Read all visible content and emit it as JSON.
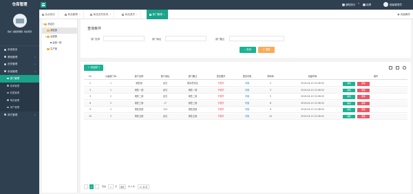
{
  "app": {
    "title": "仓库管理"
  },
  "topbar": {
    "notice": "通知提示",
    "lock": "锁屏",
    "user": "超级管理员"
  },
  "sidebar": {
    "profile_text": "您好！超级管理员, 欢迎登录",
    "items": [
      {
        "label": "系统首页",
        "icon": "home-icon"
      },
      {
        "label": "基础管理",
        "icon": "database-icon"
      },
      {
        "label": "进货管理",
        "icon": "cart-icon"
      },
      {
        "label": "系统管理",
        "icon": "gear-icon"
      }
    ],
    "sub_items": [
      {
        "label": "部门管理",
        "active": true
      },
      {
        "label": "菜单管理"
      },
      {
        "label": "权限管理"
      },
      {
        "label": "角色管理"
      },
      {
        "label": "用户管理"
      }
    ],
    "other": {
      "label": "其它管理",
      "icon": "grid-icon"
    }
  },
  "tabs": [
    {
      "label": "后台首页"
    },
    {
      "label": "商品管理"
    },
    {
      "label": "商品进货查询"
    },
    {
      "label": "商品退货"
    },
    {
      "label": "部门管理",
      "active": true
    }
  ],
  "page_ops": "页面操作",
  "tree": {
    "nodes": [
      {
        "label": "总经办"
      },
      {
        "label": "销售部"
      },
      {
        "label": "运营部"
      },
      {
        "label": "运营一部"
      },
      {
        "label": "生产部"
      }
    ]
  },
  "search": {
    "title": "查询条件",
    "fields": [
      {
        "label": "部门名称",
        "value": ""
      },
      {
        "label": "部门地址",
        "value": ""
      },
      {
        "label": "部门备注",
        "value": ""
      }
    ],
    "search_btn": "查询",
    "reset_btn": "重置"
  },
  "table": {
    "add_btn": "添加部门",
    "columns": [
      "ID",
      "父级部门ID",
      "部门名称",
      "部门地址",
      "部门备注",
      "是否展开",
      "是否可用",
      "排序码",
      "创建时间",
      "操作"
    ],
    "rows": [
      [
        "2",
        "1",
        "销售部",
        "武汉",
        "程序员屌丝",
        "不展开",
        "可用",
        "2",
        "2019-04-10 22:06:32"
      ],
      [
        "3",
        "1",
        "销售一部",
        "武汉",
        "销售一部",
        "不展开",
        "可用",
        "3",
        "2019-04-10 22:06:32"
      ],
      [
        "5",
        "2",
        "销售二部",
        "武汉",
        "销售二部",
        "不展开",
        "可用",
        "5",
        "2019-04-10 22:06:32"
      ],
      [
        "8",
        "2",
        "销售三部",
        "17",
        "销售三部",
        "不展开",
        "可用",
        "8",
        "2019-04-10 22:06:32"
      ],
      [
        "9",
        "2",
        "销售四部",
        "123",
        "销售四部",
        "不展开",
        "可用",
        "9",
        "2019-04-13 22:08:32"
      ],
      [
        "10",
        "2",
        "销售五部",
        "武汉",
        "销售五部",
        "不展开",
        "可用",
        "10",
        "2019-04-13 22:08:32"
      ]
    ],
    "edit_label": "编辑",
    "delete_label": "删除"
  },
  "pager": {
    "current": "1",
    "goto_prefix": "到第",
    "page_input": "1",
    "goto_suffix": "页",
    "confirm": "确定",
    "total": "共 6 条",
    "page_size": "10 条/页"
  }
}
